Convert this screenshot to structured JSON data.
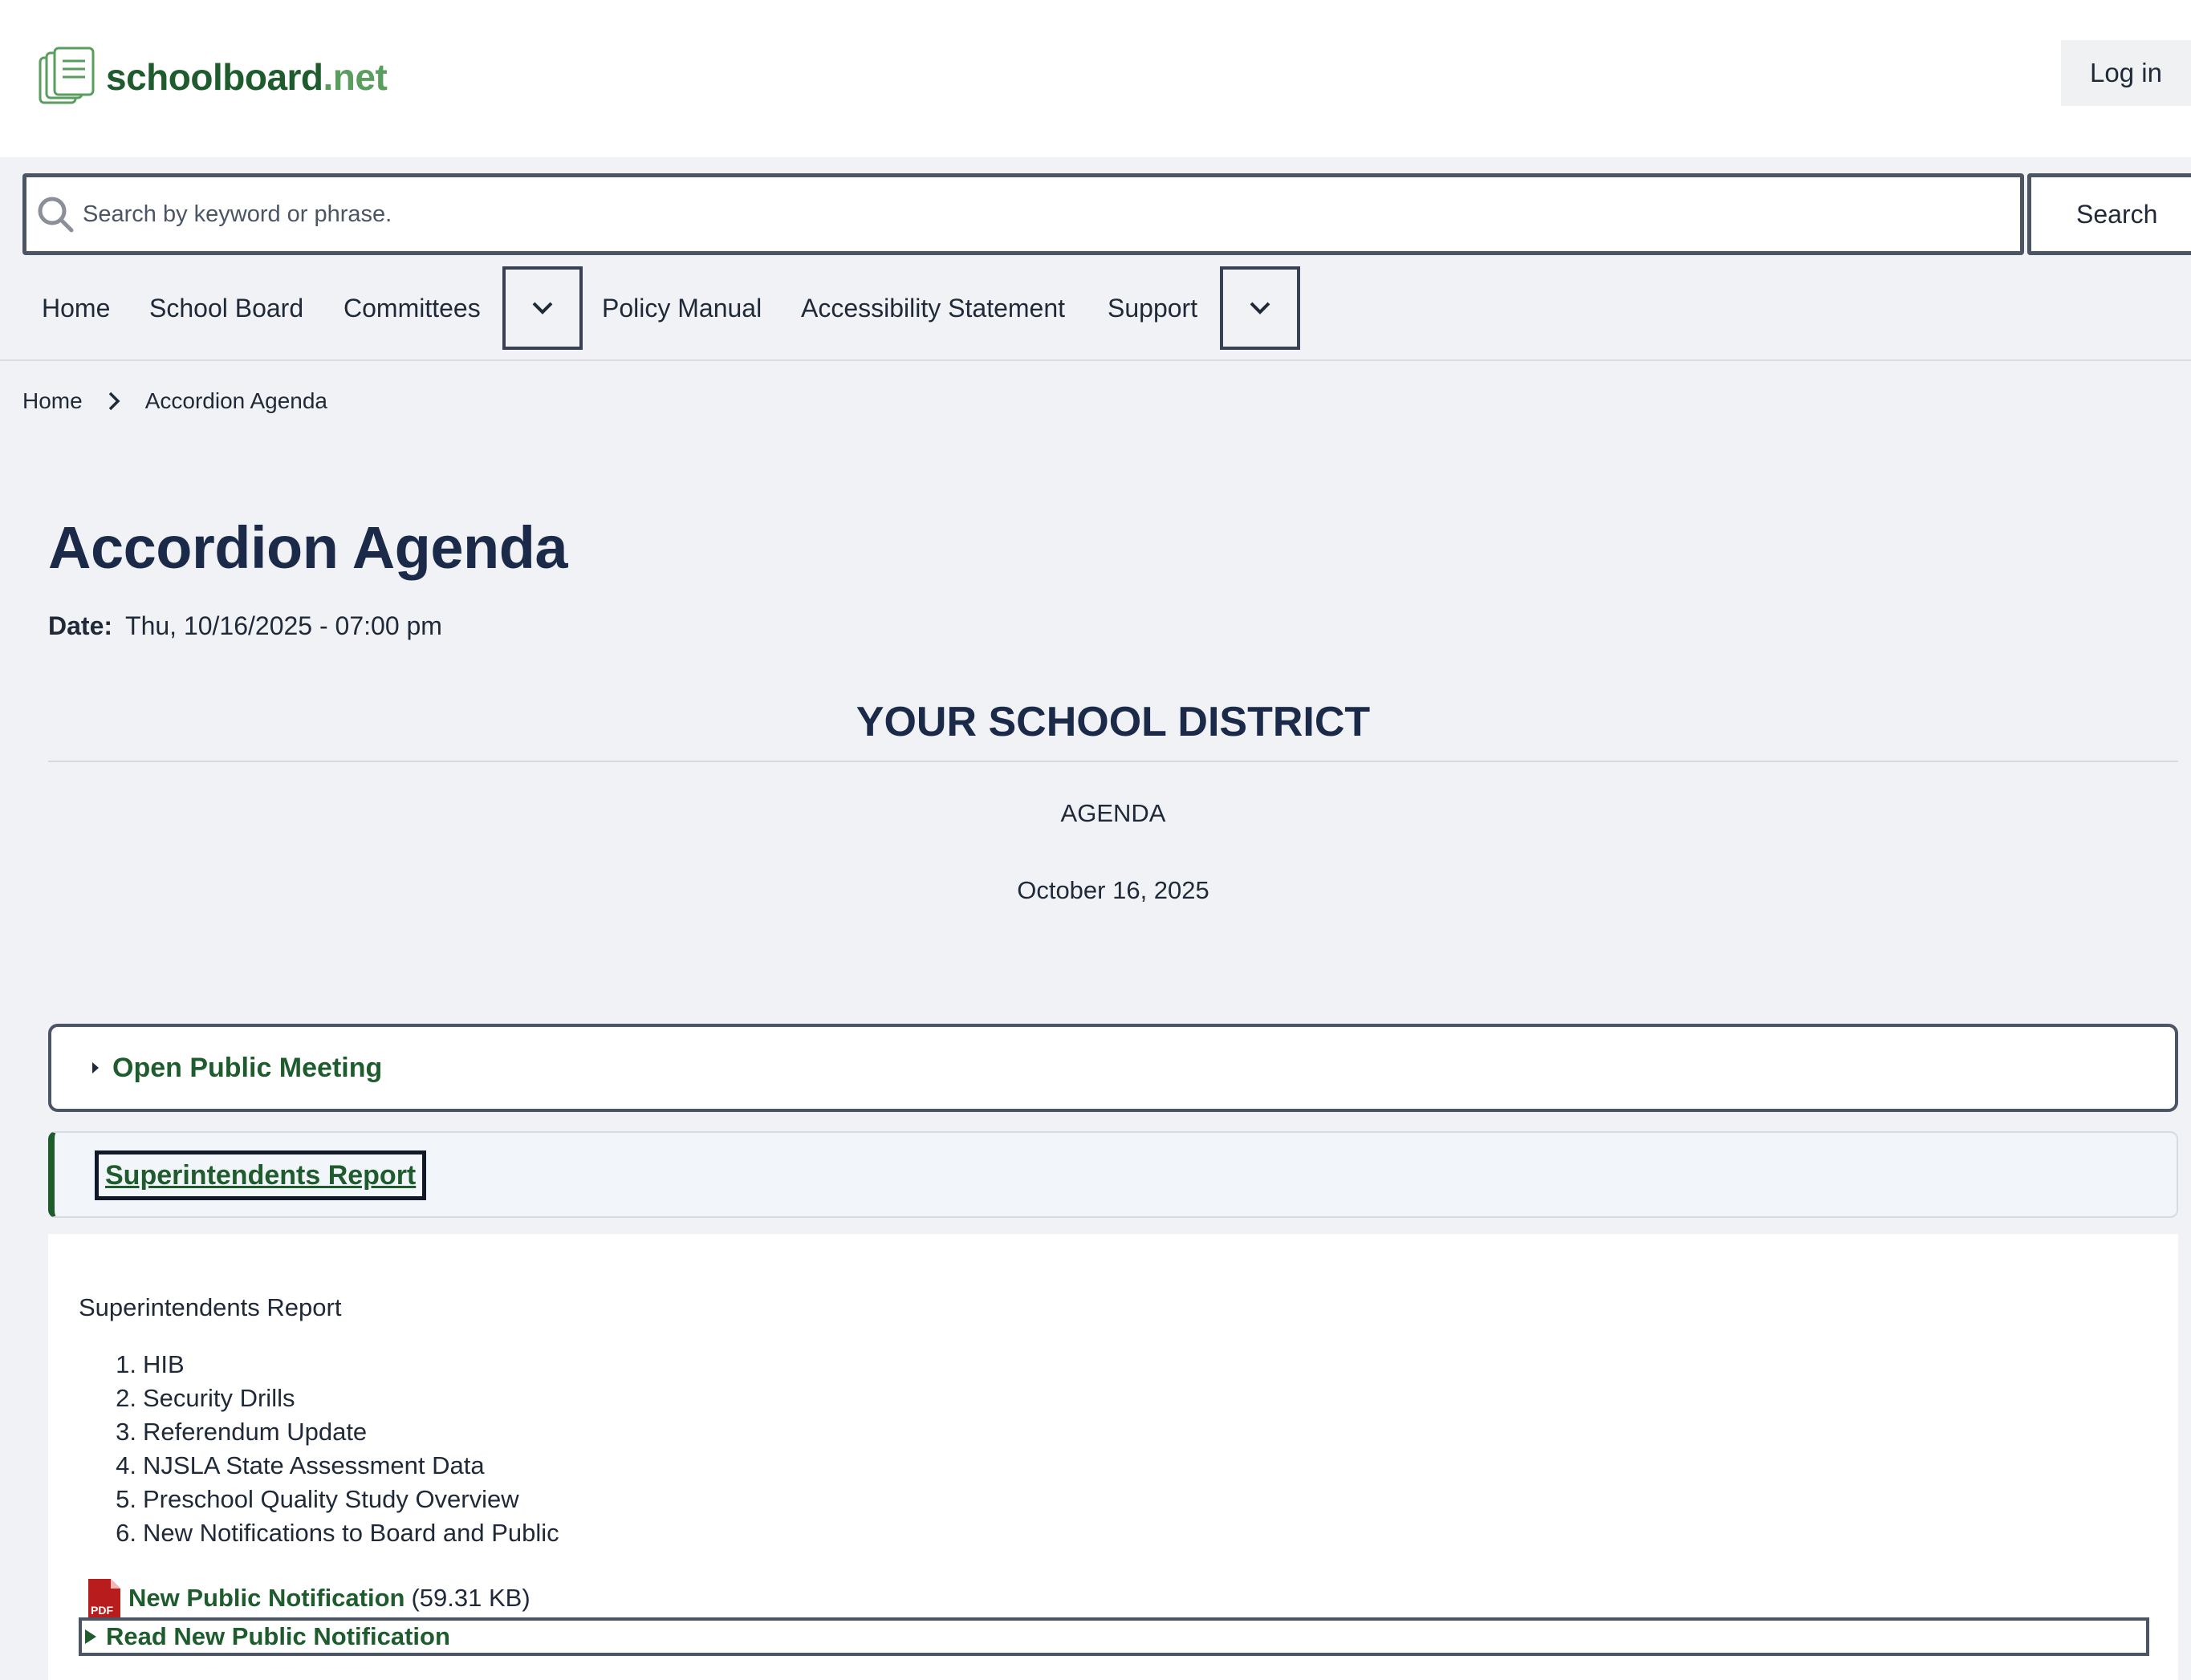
{
  "header": {
    "logo_main": "schoolboard",
    "logo_tld": ".net",
    "login_label": "Log in"
  },
  "search": {
    "placeholder": "Search by keyword or phrase.",
    "value": "",
    "button_label": "Search"
  },
  "nav": {
    "items": [
      {
        "label": "Home"
      },
      {
        "label": "School Board"
      },
      {
        "label": "Committees"
      },
      {
        "label": "Policy Manual"
      },
      {
        "label": "Accessibility Statement"
      },
      {
        "label": "Support"
      }
    ]
  },
  "breadcrumb": {
    "home": "Home",
    "current": "Accordion Agenda"
  },
  "page": {
    "title": "Accordion Agenda",
    "date_label": "Date:",
    "date_value": "Thu, 10/16/2025 - 07:00 pm",
    "district": "YOUR SCHOOL DISTRICT",
    "agenda_label": "AGENDA",
    "agenda_date": "October 16, 2025"
  },
  "accordion": {
    "closed_title": "Open Public Meeting",
    "open_title": "Superintendents Report",
    "body_heading": "Superintendents Report",
    "list": [
      {
        "num": "1.",
        "text": "HIB"
      },
      {
        "num": "2.",
        "text": "Security Drills"
      },
      {
        "num": "3.",
        "text": "Referendum Update"
      },
      {
        "num": "4.",
        "text": "NJSLA State Assessment Data"
      },
      {
        "num": "5.",
        "text": "Preschool Quality Study Overview"
      },
      {
        "num": "6.",
        "text": "New Notifications to Board and Public"
      }
    ],
    "file_name": "New Public Notification",
    "file_size": "(59.31 KB)",
    "file_icon_text": "PDF",
    "read_label": "Read New Public Notification"
  },
  "colors": {
    "brand_green": "#1e5c2e",
    "brand_light_green": "#5a9e5f",
    "title_navy": "#1b2a48",
    "pdf_red": "#b91c1c"
  },
  "icons": {
    "logo": "document-stack-icon",
    "search": "search-icon",
    "nav_toggle": "chevron-down-icon",
    "breadcrumb_sep": "chevron-right-icon",
    "caret": "caret-right-icon",
    "pdf": "pdf-file-icon"
  }
}
